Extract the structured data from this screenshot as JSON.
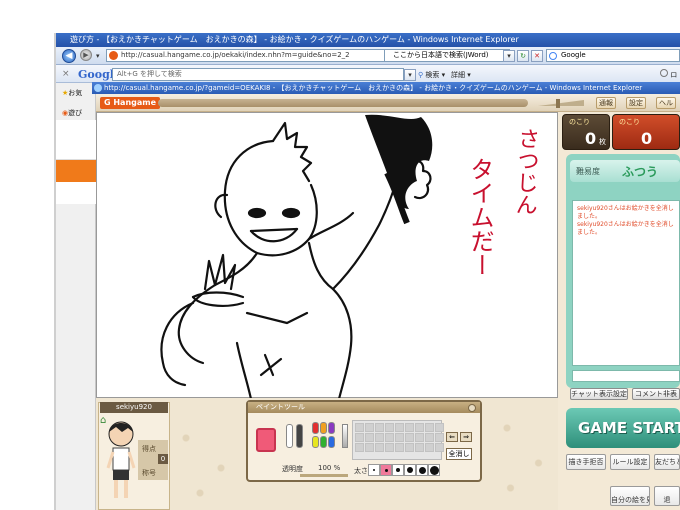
{
  "browser": {
    "title": "遊び方 - 【おえかきチャットゲーム　おえかきの森】 - お絵かき・クイズゲームのハンゲーム - Windows Internet Explorer",
    "address": "http://casual.hangame.co.jp/oekaki/index.nhn?m=guide&no=2_2",
    "search_hint": "ここから日本語で検索(JWord)",
    "google_search": "Google",
    "google_brand": "Google",
    "toolbar_search_placeholder": "Alt+G を押して検索",
    "toolbar_search_btn": "検索",
    "toolbar_details": "詳細",
    "toolbar_right": "ログ",
    "fav_label": "お気",
    "fav2_label": "遊び"
  },
  "game_window": {
    "title": "http://casual.hangame.co.jp/?gameid=OEKAKI8 - 【おえかきチャットゲーム　おえかきの森】 - お絵かき・クイズゲームのハンゲーム - Windows Internet Explorer",
    "logo": "Hangame",
    "btn_notify": "通報",
    "btn_settings": "設定",
    "btn_help": "ヘル"
  },
  "canvas": {
    "text_line1": "さつじん",
    "text_line2": "タイムだー"
  },
  "counters": {
    "left_label": "のこり",
    "left_value": "0",
    "left_unit": "枚",
    "right_label": "のこり",
    "right_value": "0"
  },
  "chat": {
    "difficulty_label": "難易度",
    "difficulty_value": "ふつう",
    "messages": [
      "sekiyu920さんはお絵かきを全消しました。",
      "sekiyu920さんはお絵かきを全消しました。"
    ],
    "btn_display": "チャット表示設定",
    "btn_comment": "コメント非表"
  },
  "game_start": "GAME START",
  "menu": {
    "btn1": "描き手拒否",
    "btn2": "ルール設定",
    "btn3": "友だちと",
    "btn4": "自分の絵を見る",
    "btn5": "退"
  },
  "player": {
    "name": "sekiyu920",
    "rank_label1": "得点",
    "rank_value": "0",
    "rank_label2": "称号"
  },
  "paint_tool": {
    "title": "ペイントツール",
    "opacity_label": "透明度",
    "opacity_value": "100 %",
    "size_label": "太さ",
    "clear_button": "全消し"
  }
}
